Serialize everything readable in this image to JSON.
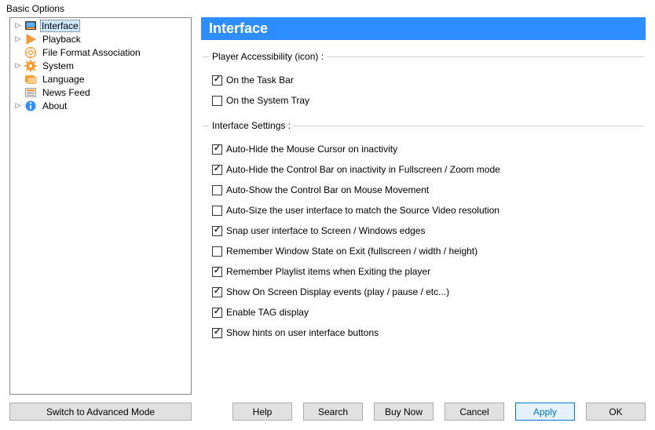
{
  "window": {
    "title": "Basic Options"
  },
  "sidebar": {
    "items": [
      {
        "label": "Interface",
        "expandable": true,
        "selected": true,
        "icon": "interface"
      },
      {
        "label": "Playback",
        "expandable": true,
        "selected": false,
        "icon": "playback"
      },
      {
        "label": "File Format Association",
        "expandable": false,
        "selected": false,
        "icon": "fileformat"
      },
      {
        "label": "System",
        "expandable": true,
        "selected": false,
        "icon": "system"
      },
      {
        "label": "Language",
        "expandable": false,
        "selected": false,
        "icon": "language"
      },
      {
        "label": "News Feed",
        "expandable": false,
        "selected": false,
        "icon": "newsfeed"
      },
      {
        "label": "About",
        "expandable": true,
        "selected": false,
        "icon": "about"
      }
    ]
  },
  "panel": {
    "header": "Interface",
    "group1": {
      "title": "Player Accessibility (icon) :",
      "options": [
        {
          "label": "On the Task Bar",
          "checked": true
        },
        {
          "label": "On the System Tray",
          "checked": false
        }
      ]
    },
    "group2": {
      "title": "Interface Settings :",
      "options": [
        {
          "label": "Auto-Hide the Mouse Cursor on inactivity",
          "checked": true
        },
        {
          "label": "Auto-Hide the Control Bar on inactivity in Fullscreen / Zoom mode",
          "checked": true
        },
        {
          "label": "Auto-Show the Control Bar on Mouse Movement",
          "checked": false
        },
        {
          "label": "Auto-Size the user interface to match the Source Video resolution",
          "checked": false
        },
        {
          "label": "Snap user interface to Screen / Windows edges",
          "checked": true
        },
        {
          "label": "Remember Window State on Exit (fullscreen / width / height)",
          "checked": false
        },
        {
          "label": "Remember Playlist items when Exiting the player",
          "checked": true
        },
        {
          "label": "Show On Screen Display events (play / pause / etc...)",
          "checked": true
        },
        {
          "label": "Enable TAG display",
          "checked": true
        },
        {
          "label": "Show hints on user interface buttons",
          "checked": true
        }
      ]
    }
  },
  "buttons": {
    "advanced": "Switch to Advanced Mode",
    "help": "Help",
    "search": "Search",
    "buy": "Buy Now",
    "cancel": "Cancel",
    "apply": "Apply",
    "ok": "OK"
  }
}
